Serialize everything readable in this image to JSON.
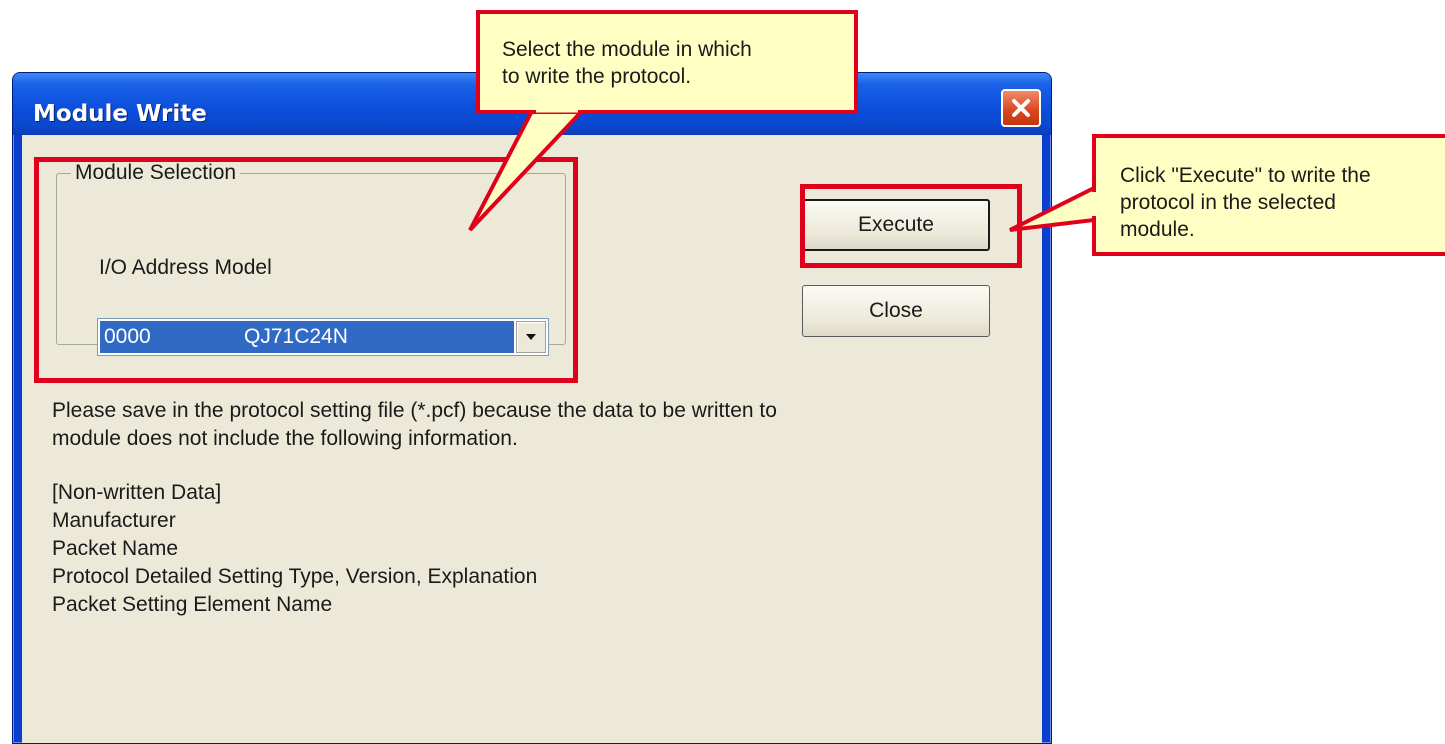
{
  "window": {
    "title": "Module Write",
    "close_icon": "close-icon"
  },
  "module_selection": {
    "group_label": "Module Selection",
    "io_label": "I/O Address Model",
    "selected_address": "0000",
    "selected_model": "QJ71C24N",
    "dropdown_icon": "chevron-down-icon"
  },
  "buttons": {
    "execute": "Execute",
    "close": "Close"
  },
  "info": {
    "notice_lines": [
      "Please save in the protocol setting file (*.pcf) because the data to be written to",
      "module does not include the following information."
    ],
    "non_written_lines": [
      "[Non-written Data]",
      "Manufacturer",
      "Packet Name",
      "Protocol Detailed Setting Type, Version, Explanation",
      "Packet Setting Element Name"
    ]
  },
  "annotations": {
    "module_callout_lines": [
      "Select the module in which",
      "to write the protocol."
    ],
    "execute_callout_lines": [
      "Click \"Execute\" to write the",
      "protocol in the selected",
      "module."
    ],
    "highlight_color": "#e0001b",
    "callout_fill": "#ffffc4"
  },
  "colors": {
    "titlebar": "#0a48cf",
    "dialog_face": "#ece9d8",
    "selection": "#316ac5",
    "close_button": "#d9451e"
  }
}
